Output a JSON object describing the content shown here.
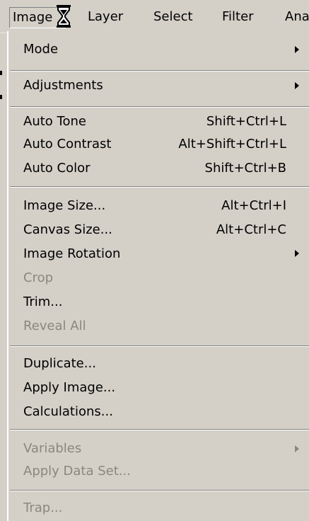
{
  "menubar": {
    "items": [
      {
        "label": "Image"
      },
      {
        "label": "Layer"
      },
      {
        "label": "Select"
      },
      {
        "label": "Filter"
      },
      {
        "label": "Ana"
      }
    ]
  },
  "menu": {
    "items": [
      {
        "label": "Mode",
        "shortcut": "",
        "submenu": true,
        "enabled": true
      },
      {
        "label": "Adjustments",
        "shortcut": "",
        "submenu": true,
        "enabled": true
      },
      {
        "label": "Auto Tone",
        "shortcut": "Shift+Ctrl+L",
        "enabled": true
      },
      {
        "label": "Auto Contrast",
        "shortcut": "Alt+Shift+Ctrl+L",
        "enabled": true
      },
      {
        "label": "Auto Color",
        "shortcut": "Shift+Ctrl+B",
        "enabled": true
      },
      {
        "label": "Image Size...",
        "shortcut": "Alt+Ctrl+I",
        "enabled": true
      },
      {
        "label": "Canvas Size...",
        "shortcut": "Alt+Ctrl+C",
        "enabled": true
      },
      {
        "label": "Image Rotation",
        "shortcut": "",
        "submenu": true,
        "enabled": true
      },
      {
        "label": "Crop",
        "shortcut": "",
        "enabled": false
      },
      {
        "label": "Trim...",
        "shortcut": "",
        "enabled": true
      },
      {
        "label": "Reveal All",
        "shortcut": "",
        "enabled": false
      },
      {
        "label": "Duplicate...",
        "shortcut": "",
        "enabled": true
      },
      {
        "label": "Apply Image...",
        "shortcut": "",
        "enabled": true
      },
      {
        "label": "Calculations...",
        "shortcut": "",
        "enabled": true
      },
      {
        "label": "Variables",
        "shortcut": "",
        "submenu": true,
        "enabled": false
      },
      {
        "label": "Apply Data Set...",
        "shortcut": "",
        "enabled": false
      },
      {
        "label": "Trap...",
        "shortcut": "",
        "enabled": false
      }
    ]
  },
  "icons": {
    "cursor": "hourglass-cursor-icon",
    "submenu": "submenu-arrow-icon"
  },
  "colors": {
    "menu_bg": "#d4d0c8",
    "disabled_text": "#8a877f",
    "separator_dark": "#808080",
    "separator_light": "#ffffff"
  }
}
